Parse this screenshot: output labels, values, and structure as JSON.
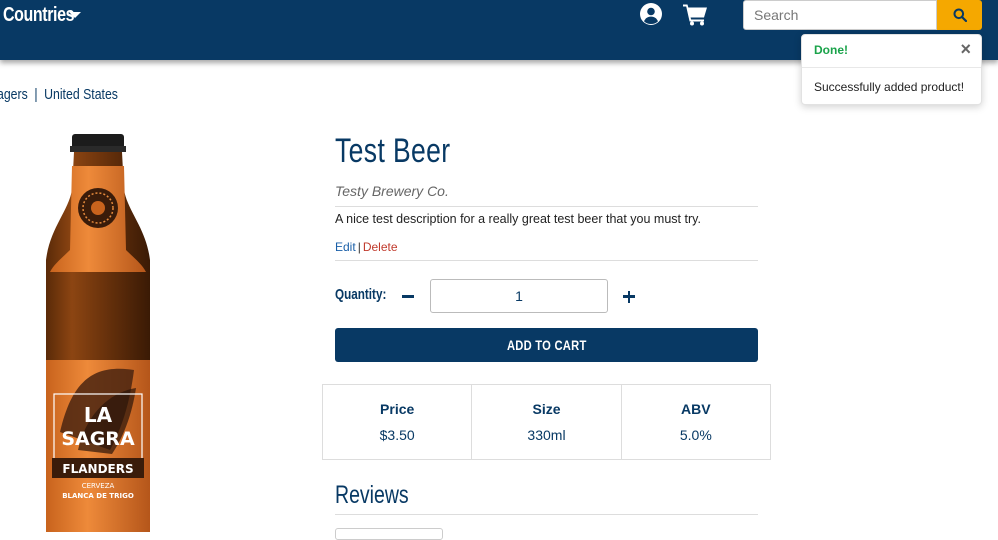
{
  "navbar": {
    "countries_label": "Countries",
    "search_placeholder": "Search"
  },
  "breadcrumb": {
    "items": [
      "agers",
      "United States"
    ],
    "separator": "|"
  },
  "product": {
    "title": "Test Beer",
    "brewery": "Testy Brewery Co.",
    "description": "A nice test description for a really great test beer that you must try.",
    "edit_label": "Edit",
    "separator": "|",
    "delete_label": "Delete",
    "quantity_label": "Quantity:",
    "quantity_value": "1",
    "add_to_cart_label": "ADD TO CART",
    "stats": [
      {
        "label": "Price",
        "value": "$3.50"
      },
      {
        "label": "Size",
        "value": "330ml"
      },
      {
        "label": "ABV",
        "value": "5.0%"
      }
    ],
    "reviews_heading": "Reviews",
    "label_art": {
      "line1": "LA",
      "line2": "SAGRA",
      "line3": "FLANDERS",
      "line4": "CERVEZA",
      "line5": "BLANCA DE TRIGO"
    }
  },
  "toast": {
    "title": "Done!",
    "close_glyph": "×",
    "message": "Successfully added product!"
  },
  "colors": {
    "navy": "#083964",
    "accent": "#f5a800",
    "success": "#1aa34a",
    "danger": "#c0392b",
    "link": "#1a5fa8"
  },
  "icons": [
    "chevron-down-icon",
    "user-circle-icon",
    "shopping-cart-icon",
    "search-icon",
    "close-icon",
    "minus-icon",
    "plus-icon"
  ]
}
